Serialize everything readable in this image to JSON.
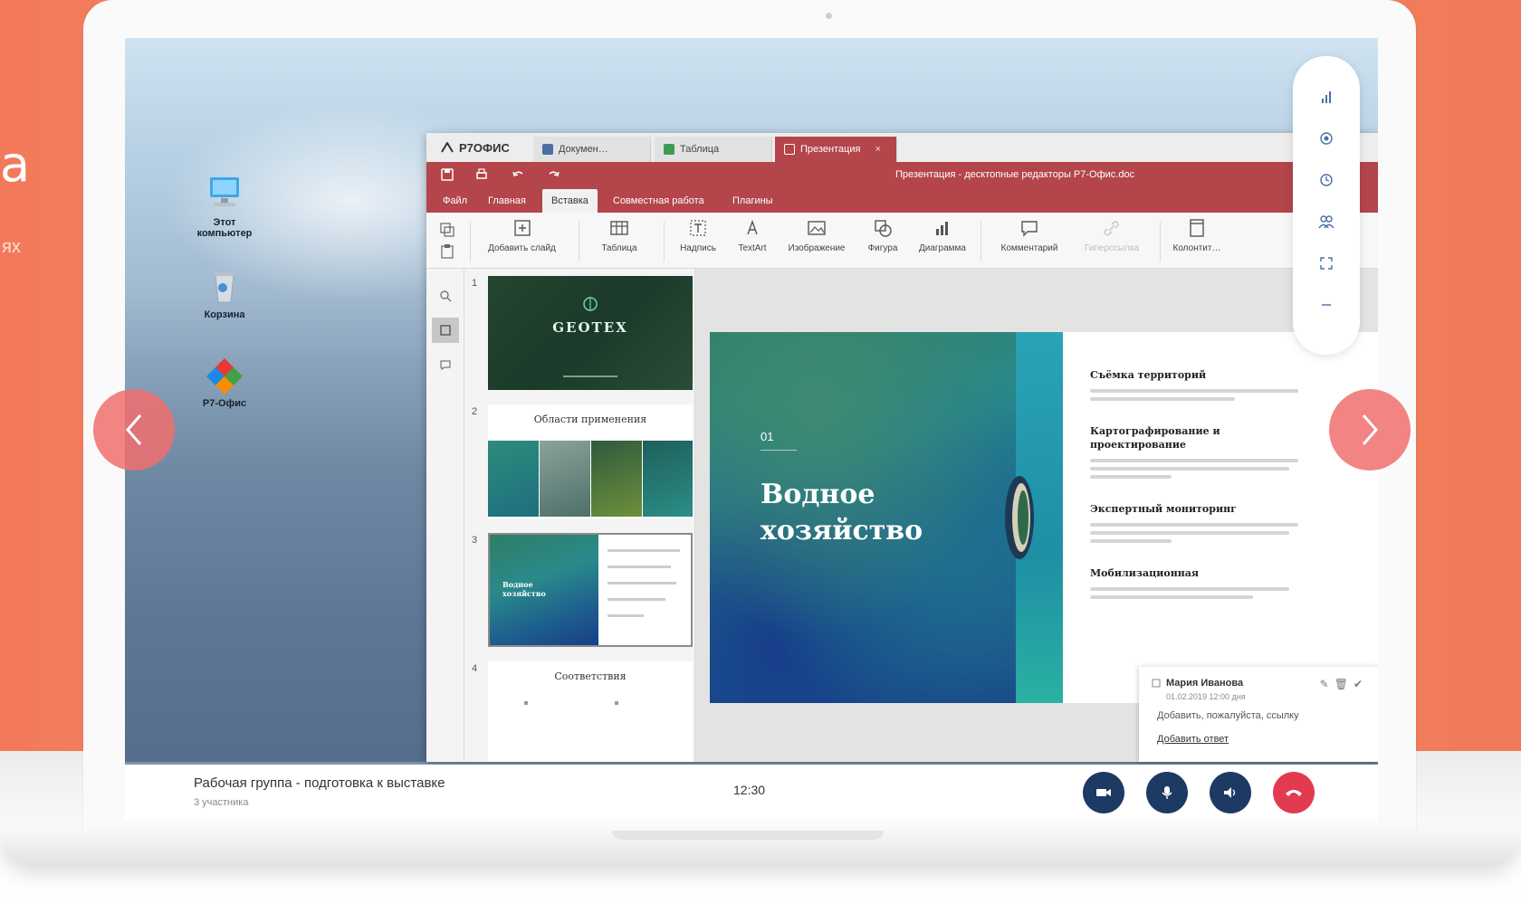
{
  "promo": {
    "letter": "а",
    "sub": "ях"
  },
  "desktop": {
    "icons": [
      {
        "label_line1": "Этот",
        "label_line2": "компьютер"
      },
      {
        "label_line1": "Корзина",
        "label_line2": ""
      },
      {
        "label_line1": "Р7-Офис",
        "label_line2": ""
      }
    ]
  },
  "app": {
    "brand": "Р7ОФИС",
    "tabs": [
      {
        "label": "Докумен…",
        "color": "#4a6fa5"
      },
      {
        "label": "Таблица",
        "color": "#3f9a56"
      },
      {
        "label": "Презентация",
        "color": "#ffffff",
        "close": "×"
      }
    ],
    "doc_title": "Презентация - десктопные редакторы Р7-Офис.doc",
    "menu": [
      "Файл",
      "Главная",
      "Вставка",
      "Совместная работа",
      "Плагины"
    ],
    "active_menu": "Вставка",
    "ribbon": [
      {
        "label": "Добавить слайд",
        "icon": "add-slide"
      },
      {
        "label": "Таблица",
        "icon": "table"
      },
      {
        "label": "Надпись",
        "icon": "textbox"
      },
      {
        "label": "TextArt",
        "icon": "textart"
      },
      {
        "label": "Изображение",
        "icon": "image"
      },
      {
        "label": "Фигура",
        "icon": "shape"
      },
      {
        "label": "Диаграмма",
        "icon": "chart"
      },
      {
        "label": "Комментарий",
        "icon": "comment"
      },
      {
        "label": "Гиперссылка",
        "icon": "link"
      },
      {
        "label": "Колонтит…",
        "icon": "header"
      }
    ],
    "thumbnails": [
      {
        "num": "1",
        "title": "GEOTEX"
      },
      {
        "num": "2",
        "title": "Области применения"
      },
      {
        "num": "3",
        "title": ""
      },
      {
        "num": "4",
        "title": "Соответствия"
      }
    ],
    "slide": {
      "number": "01",
      "title": "Водное хозяйство",
      "right_items": [
        "Съёмка территорий",
        "Картографирование и проектирование",
        "Экспертный мониторинг",
        "Мобилизационная"
      ]
    },
    "comment": {
      "name": "Мария Иванова",
      "date": "01.02.2019 12:00 дня",
      "text": "Добавить, пожалуйста, ссылку",
      "reply": "Добавить ответ"
    }
  },
  "call": {
    "title": "Рабочая группа - подготовка к выставке",
    "participants": "3 участника",
    "time": "12:30",
    "colors": {
      "dark": "#1c3a63",
      "red": "#e23b4f"
    }
  },
  "colors": {
    "accent": "#b3454b",
    "promo": "#f27a5a"
  }
}
